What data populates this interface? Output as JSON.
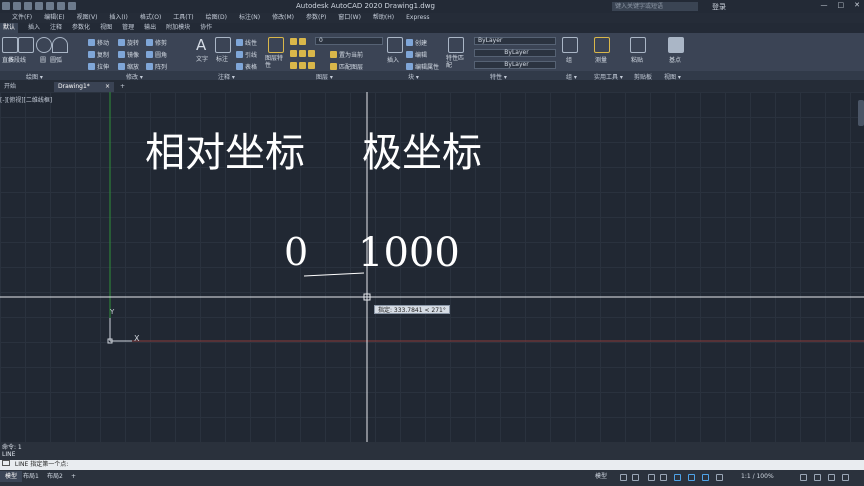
{
  "titlebar": {
    "title": "Autodesk AutoCAD 2020    Drawing1.dwg",
    "search_placeholder": "键入关键字或短语",
    "login": "登录",
    "window_buttons": [
      "—",
      "□",
      "✕"
    ]
  },
  "menubar": {
    "items": [
      "文件(F)",
      "编辑(E)",
      "视图(V)",
      "插入(I)",
      "格式(O)",
      "工具(T)",
      "绘图(D)",
      "标注(N)",
      "修改(M)",
      "参数(P)",
      "窗口(W)",
      "帮助(H)",
      "Express"
    ]
  },
  "ribbon_tabs": {
    "items": [
      "默认",
      "插入",
      "注释",
      "参数化",
      "视图",
      "管理",
      "输出",
      "附加模块",
      "协作"
    ]
  },
  "ribbon": {
    "draw": {
      "buttons": [
        "直线",
        "多段线",
        "圆",
        "圆弧"
      ]
    },
    "modify": {
      "buttons": [
        "移动",
        "旋转",
        "修剪",
        "复制",
        "镜像",
        "圆角",
        "拉伸",
        "缩放",
        "阵列"
      ]
    },
    "annotation": {
      "buttons": [
        "文字",
        "标注",
        "线性",
        "引线",
        "表格"
      ]
    },
    "layers": {
      "buttons": [
        "图层特性",
        "置为当前",
        "匹配图层"
      ],
      "current_layer": "0"
    },
    "block": {
      "buttons": [
        "插入",
        "创建",
        "编辑",
        "编辑属性"
      ]
    },
    "properties": {
      "buttons": [
        "特性匹配"
      ],
      "color": "ByLayer",
      "linetype": "ByLayer",
      "lineweight": "ByLayer"
    },
    "groups": {
      "button": "组"
    },
    "utilities": {
      "button": "测量"
    },
    "clipboard": {
      "button": "粘贴"
    },
    "view": {
      "button": "基点"
    }
  },
  "panel_titles": {
    "draw": "绘图 ▾",
    "modify": "修改 ▾",
    "annotation": "注释 ▾",
    "layers": "图层 ▾",
    "block": "块 ▾",
    "properties": "特性 ▾",
    "groups": "组 ▾",
    "utilities": "实用工具 ▾",
    "clipboard": "剪贴板",
    "view": "视图 ▾"
  },
  "file_tabs": {
    "start": "开始",
    "drawing": "Drawing1*",
    "close": "×",
    "add": "+"
  },
  "canvas": {
    "viewport_label": "[-][俯视][二维线框]",
    "heading_relative": "相对坐标",
    "heading_polar": "极坐标",
    "value_zero": "0",
    "value_thousand": "1000",
    "coord_tooltip": "指定: 333.7841 < 271°",
    "ucs_y": "Y",
    "ucs_x": "X",
    "colors": {
      "background": "#212833",
      "grid": "#2a323e",
      "crosshair": "#e6e9ee",
      "ucs_axis_y": "#2f8f3a",
      "ucs_axis_x": "#8a3b3b"
    }
  },
  "command": {
    "history": [
      "命令: 1",
      "LINE"
    ],
    "prompt": "LINE 指定第一个点:"
  },
  "statusbar": {
    "tabs": [
      "模型",
      "布局1",
      "布局2"
    ],
    "add": "+",
    "model_label": "模型",
    "scale": "1:1 / 100%"
  }
}
